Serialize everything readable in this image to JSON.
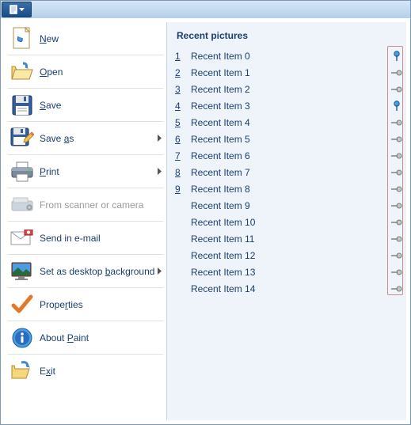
{
  "app_menu": {
    "tooltip": "Application Menu"
  },
  "menu": {
    "new": {
      "label": "New",
      "accel_idx": 0
    },
    "open": {
      "label": "Open",
      "accel_idx": 0
    },
    "save": {
      "label": "Save",
      "accel_idx": 0
    },
    "saveas": {
      "label": "Save as",
      "accel_idx": 5,
      "has_submenu": true
    },
    "print": {
      "label": "Print",
      "accel_idx": 0,
      "has_submenu": true
    },
    "scan": {
      "label": "From scanner or camera",
      "disabled": true
    },
    "email": {
      "label": "Send in e-mail"
    },
    "wallpaper": {
      "label": "Set as desktop background",
      "accel_idx": 15,
      "has_submenu": true
    },
    "properties": {
      "label": "Properties",
      "accel_idx": 5
    },
    "about": {
      "label": "About Paint",
      "accel_idx": 6
    },
    "exit": {
      "label": "Exit",
      "accel_idx": 1
    }
  },
  "recent": {
    "header": "Recent pictures",
    "items": [
      {
        "num": "1",
        "label": "Recent Item 0",
        "pinned": true
      },
      {
        "num": "2",
        "label": "Recent Item 1",
        "pinned": false
      },
      {
        "num": "3",
        "label": "Recent Item 2",
        "pinned": false
      },
      {
        "num": "4",
        "label": "Recent Item 3",
        "pinned": true
      },
      {
        "num": "5",
        "label": "Recent Item 4",
        "pinned": false
      },
      {
        "num": "6",
        "label": "Recent Item 5",
        "pinned": false
      },
      {
        "num": "7",
        "label": "Recent Item 6",
        "pinned": false
      },
      {
        "num": "8",
        "label": "Recent Item 7",
        "pinned": false
      },
      {
        "num": "9",
        "label": "Recent Item 8",
        "pinned": false
      },
      {
        "num": "",
        "label": "Recent Item 9",
        "pinned": false
      },
      {
        "num": "",
        "label": "Recent Item 10",
        "pinned": false
      },
      {
        "num": "",
        "label": "Recent Item 11",
        "pinned": false
      },
      {
        "num": "",
        "label": "Recent Item 12",
        "pinned": false
      },
      {
        "num": "",
        "label": "Recent Item 13",
        "pinned": false
      },
      {
        "num": "",
        "label": "Recent Item 14",
        "pinned": false
      }
    ]
  }
}
